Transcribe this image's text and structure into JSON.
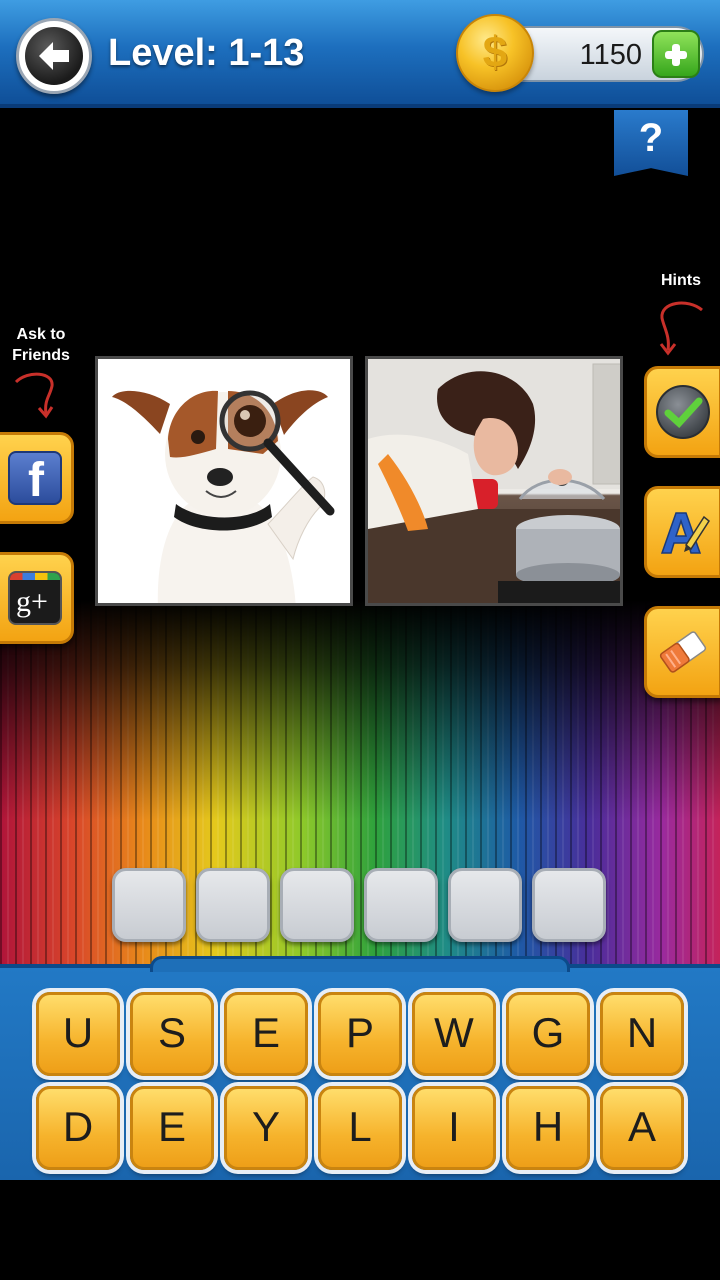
{
  "header": {
    "level_text": "Level: 1-13",
    "coins": "1150"
  },
  "icons": {
    "back": "back-arrow-icon",
    "coin": "dollar-coin-icon",
    "plus": "plus-icon",
    "help": "question-mark-icon",
    "facebook": "facebook-icon",
    "google_plus": "google-plus-icon",
    "check": "checkmark-icon",
    "reveal": "letter-a-pencil-icon",
    "eraser": "eraser-icon"
  },
  "help_label": "?",
  "coin_symbol": "$",
  "social": {
    "label": "Ask to Friends",
    "facebook_glyph": "f",
    "google_glyph": "g+"
  },
  "hints": {
    "label": "Hints"
  },
  "answer": {
    "slots": [
      "",
      "",
      "",
      "",
      "",
      ""
    ]
  },
  "keyboard": {
    "row1": [
      "U",
      "S",
      "E",
      "P",
      "W",
      "G",
      "N"
    ],
    "row2": [
      "D",
      "E",
      "Y",
      "L",
      "I",
      "H",
      "A"
    ]
  },
  "colors": {
    "topbar": "#1d6fbe",
    "key": "#f6b32c",
    "keyboard_bg": "#1a65ad"
  }
}
